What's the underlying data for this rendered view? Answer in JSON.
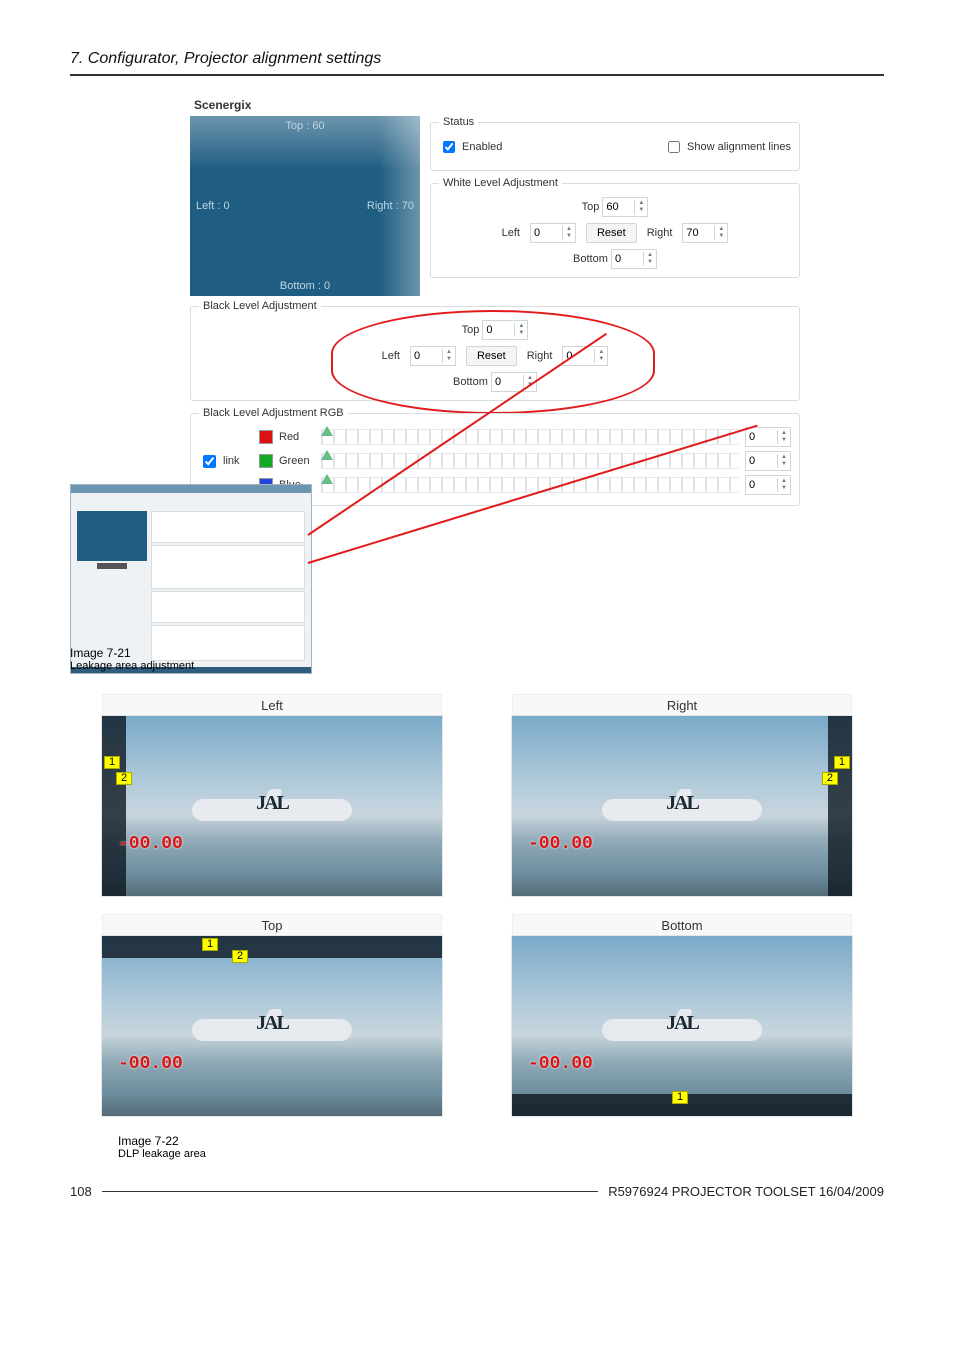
{
  "header": {
    "title": "7. Configurator, Projector alignment settings"
  },
  "scenergix": {
    "title": "Scenergix",
    "preview": {
      "top": "Top : 60",
      "left": "Left : 0",
      "right": "Right : 70",
      "bottom": "Bottom : 0"
    },
    "status": {
      "legend": "Status",
      "enabled_label": "Enabled",
      "show_lines_label": "Show alignment lines"
    },
    "white": {
      "legend": "White Level Adjustment",
      "top_label": "Top",
      "top_value": "60",
      "left_label": "Left",
      "left_value": "0",
      "reset_label": "Reset",
      "right_label": "Right",
      "right_value": "70",
      "bottom_label": "Bottom",
      "bottom_value": "0"
    },
    "black": {
      "legend": "Black Level Adjustment",
      "top_label": "Top",
      "top_value": "0",
      "left_label": "Left",
      "left_value": "0",
      "reset_label": "Reset",
      "right_label": "Right",
      "right_value": "0",
      "bottom_label": "Bottom",
      "bottom_value": "0"
    },
    "black_rgb": {
      "legend": "Black Level Adjustment RGB",
      "link_label": "link",
      "red_label": "Red",
      "red_value": "0",
      "green_label": "Green",
      "green_value": "0",
      "blue_label": "Blue",
      "blue_value": "0"
    }
  },
  "caption1": {
    "id": "Image 7-21",
    "text": "Leakage area adjustment"
  },
  "grid": {
    "left": {
      "title": "Left",
      "marker1": "1",
      "marker2": "2",
      "logo": "JAL",
      "time": "-00.00"
    },
    "right": {
      "title": "Right",
      "marker1": "1",
      "marker2": "2",
      "logo": "JAL",
      "time": "-00.00"
    },
    "top": {
      "title": "Top",
      "marker1": "1",
      "marker2": "2",
      "logo": "JAL",
      "time": "-00.00"
    },
    "bottom": {
      "title": "Bottom",
      "marker1": "1",
      "logo": "JAL",
      "time": "-00.00"
    }
  },
  "caption2": {
    "id": "Image 7-22",
    "text": "DLP leakage area"
  },
  "footer": {
    "page": "108",
    "doc": "R5976924  PROJECTOR TOOLSET  16/04/2009"
  }
}
